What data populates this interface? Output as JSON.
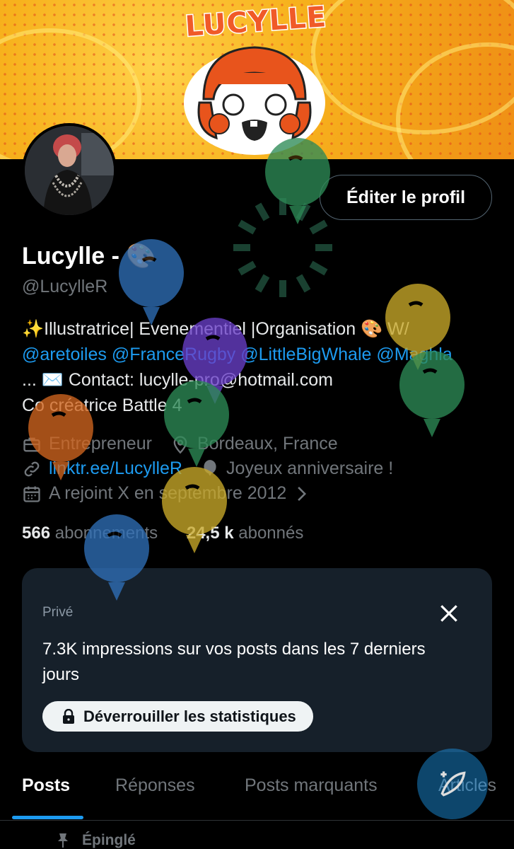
{
  "banner": {
    "logo_text": "LUCYLLE"
  },
  "profile": {
    "edit_label": "Éditer le profil",
    "name": "Lucylle - 🎨",
    "handle": "@LucylleR"
  },
  "bio": {
    "line1_prefix": "✨Illustratrice| Evenementiel |Organisation 🎨 W/",
    "mentions": [
      "@aretoiles",
      "@FranceRugby",
      "@LittleBigWhale",
      "@Maghla"
    ],
    "line3_prefix": "... ✉️ Contact: ",
    "email": "lucylle-pro@hotmail.com",
    "line4": "Co créatrice Battle 4"
  },
  "meta": {
    "job": "Entrepreneur",
    "location": "Bordeaux, France",
    "website": "linktr.ee/LucylleR",
    "birthday": "Joyeux anniversaire !",
    "joined": "A rejoint X en septembre 2012"
  },
  "follow": {
    "following_count": "566",
    "following_label": "abonnements",
    "followers_count": "24,5 k",
    "followers_label": "abonnés"
  },
  "stats_card": {
    "private_label": "Privé",
    "impressions_text": "7.3K impressions sur vos posts dans les 7 derniers jours",
    "unlock_label": "Déverrouiller les statistiques"
  },
  "tabs": [
    "Posts",
    "Réponses",
    "Posts marquants",
    "Articles"
  ],
  "pinned_label": "Épinglé",
  "colors": {
    "accent": "#1d9bf0",
    "background": "#000000",
    "card": "#16202a",
    "balloon_green": "#2e8b57",
    "balloon_blue": "#2f6fb7",
    "balloon_yellow": "#c9a92a",
    "balloon_purple": "#6a3fc8",
    "balloon_orange": "#d1661f"
  },
  "icons": [
    "briefcase-icon",
    "location-pin-icon",
    "link-icon",
    "balloon-icon",
    "calendar-icon",
    "chevron-right-icon",
    "lock-icon",
    "close-icon",
    "pin-icon",
    "compose-icon"
  ]
}
